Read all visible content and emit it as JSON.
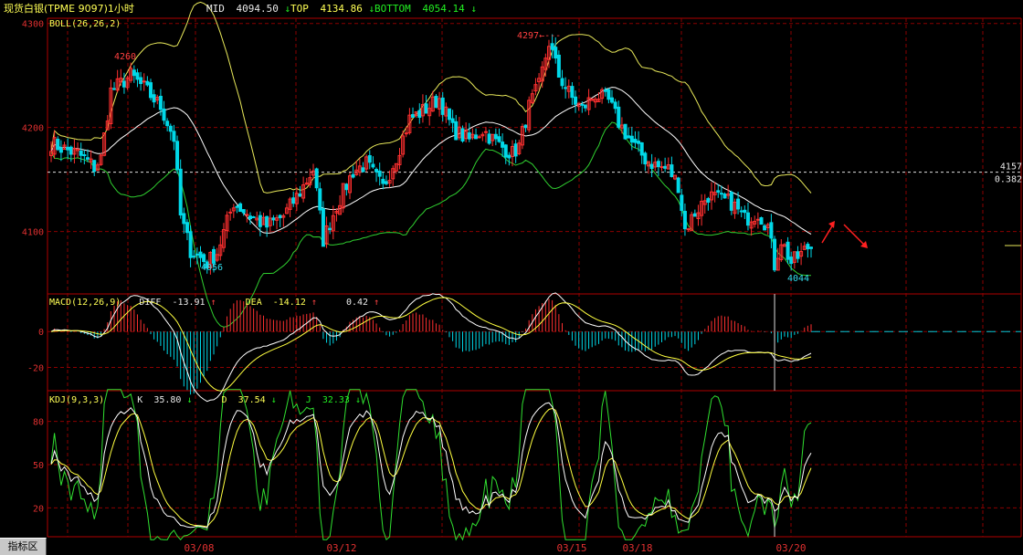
{
  "header": {
    "title": "现货白银(TPME 9097)1小时",
    "mid_label": "MID",
    "mid_value": "4094.50",
    "top_label": "TOP",
    "top_value": "4134.86",
    "bottom_label": "BOTTOM",
    "bottom_value": "4054.14",
    "arrow_down": "↓"
  },
  "boll_panel": {
    "name": "BOLL(26,26,2)",
    "yticks": [
      "4300",
      "4200",
      "4100"
    ],
    "level_value": "4157",
    "level_ratio": "0.382",
    "annotations": {
      "high1": "4260",
      "low1": "4056",
      "high2": "4297←---",
      "low2": "4044"
    }
  },
  "macd_panel": {
    "name": "MACD(12,26,9)",
    "diff_label": "DIFF",
    "diff_value": "-13.91",
    "dea_label": "DEA",
    "dea_value": "-14.12",
    "macd_value": "0.42",
    "arrow_up": "↑",
    "yticks": [
      "0",
      "-20"
    ]
  },
  "kdj_panel": {
    "name": "KDJ(9,3,3)",
    "k_label": "K",
    "k_value": "35.80",
    "d_label": "D",
    "d_value": "37.54",
    "j_label": "J",
    "j_value": "32.33",
    "arrow_down": "↓",
    "yticks": [
      "80",
      "50",
      "20"
    ]
  },
  "x_axis": {
    "dates": [
      "03/08",
      "03/12",
      "03/15",
      "03/18",
      "03/20"
    ]
  },
  "footer": {
    "indicator_tab": "指标区"
  },
  "colors": {
    "background": "#000000",
    "grid": "#8b0000",
    "up_candle": "#ff3030",
    "down_candle": "#00d8e8",
    "boll_mid": "#ffffff",
    "boll_top": "#e8e85a",
    "boll_bottom": "#30d030",
    "diff": "#ffffff",
    "dea": "#ffff40",
    "k": "#ffffff",
    "d": "#ffff40",
    "j": "#30e030"
  },
  "chart_data": [
    {
      "type": "candlestick",
      "title": "BOLL(26,26,2)",
      "ylim": [
        4040,
        4305
      ],
      "x": [
        "03/08",
        "03/12",
        "03/15",
        "03/18",
        "03/20"
      ],
      "close_anchors": [
        [
          0,
          4185
        ],
        [
          5,
          4178
        ],
        [
          8,
          4175
        ],
        [
          10,
          4170
        ],
        [
          13,
          4162
        ],
        [
          15,
          4170
        ],
        [
          18,
          4235
        ],
        [
          24,
          4250
        ],
        [
          28,
          4238
        ],
        [
          33,
          4220
        ],
        [
          37,
          4190
        ],
        [
          39,
          4115
        ],
        [
          42,
          4082
        ],
        [
          47,
          4070
        ],
        [
          50,
          4080
        ],
        [
          55,
          4128
        ],
        [
          60,
          4115
        ],
        [
          65,
          4105
        ],
        [
          70,
          4115
        ],
        [
          75,
          4138
        ],
        [
          79,
          4160
        ],
        [
          82,
          4092
        ],
        [
          86,
          4125
        ],
        [
          91,
          4158
        ],
        [
          95,
          4165
        ],
        [
          100,
          4142
        ],
        [
          104,
          4172
        ],
        [
          108,
          4208
        ],
        [
          113,
          4218
        ],
        [
          117,
          4228
        ],
        [
          121,
          4198
        ],
        [
          126,
          4188
        ],
        [
          130,
          4198
        ],
        [
          135,
          4183
        ],
        [
          139,
          4175
        ],
        [
          141,
          4182
        ],
        [
          144,
          4220
        ],
        [
          147,
          4240
        ],
        [
          150,
          4282
        ],
        [
          153,
          4250
        ],
        [
          157,
          4228
        ],
        [
          160,
          4218
        ],
        [
          164,
          4232
        ],
        [
          168,
          4225
        ],
        [
          171,
          4205
        ],
        [
          175,
          4185
        ],
        [
          179,
          4170
        ],
        [
          183,
          4162
        ],
        [
          186,
          4160
        ],
        [
          189,
          4145
        ],
        [
          191,
          4102
        ],
        [
          194,
          4118
        ],
        [
          198,
          4135
        ],
        [
          202,
          4130
        ],
        [
          205,
          4128
        ],
        [
          209,
          4112
        ],
        [
          213,
          4118
        ],
        [
          216,
          4105
        ],
        [
          218,
          4068
        ],
        [
          220,
          4092
        ],
        [
          223,
          4070
        ],
        [
          226,
          4078
        ],
        [
          228,
          4085
        ]
      ],
      "close_levels": {
        "label": "4157",
        "ratio": "0.382"
      },
      "series": [
        {
          "name": "MID",
          "last": 4094.5
        },
        {
          "name": "TOP",
          "last": 4134.86
        },
        {
          "name": "BOTTOM",
          "last": 4054.14
        }
      ],
      "annotations": [
        {
          "text": "4260",
          "x_index": 18
        },
        {
          "text": "4056",
          "x_index": 42
        },
        {
          "text": "4297",
          "x_index": 150
        },
        {
          "text": "4044",
          "x_index": 218
        }
      ]
    },
    {
      "type": "line",
      "title": "MACD(12,26,9)",
      "ylim": [
        -33,
        20
      ],
      "yticks": [
        0,
        -20
      ],
      "series": [
        {
          "name": "DIFF",
          "last": -13.91
        },
        {
          "name": "DEA",
          "last": -14.12
        },
        {
          "name": "MACD",
          "last": 0.42
        }
      ]
    },
    {
      "type": "line",
      "title": "KDJ(9,3,3)",
      "ylim": [
        0,
        100
      ],
      "yticks": [
        80,
        50,
        20
      ],
      "series": [
        {
          "name": "K",
          "last": 35.8
        },
        {
          "name": "D",
          "last": 37.54
        },
        {
          "name": "J",
          "last": 32.33
        }
      ]
    }
  ]
}
